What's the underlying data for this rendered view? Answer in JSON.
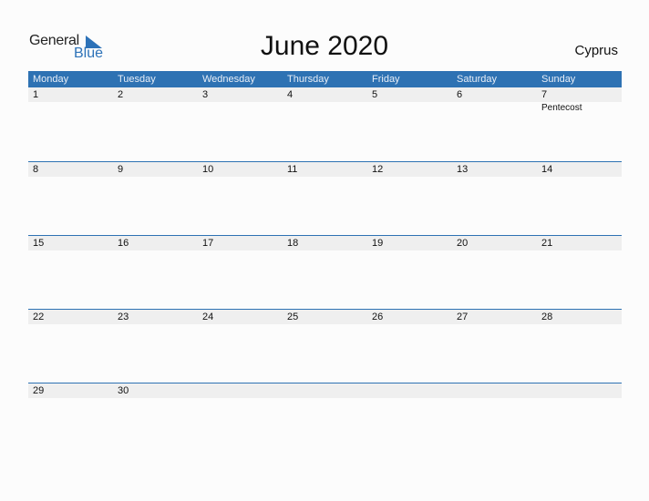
{
  "logo": {
    "general": "General",
    "blue": "Blue"
  },
  "title": "June 2020",
  "country": "Cyprus",
  "colors": {
    "accent": "#2e72b3",
    "day_row_bg": "#efefef"
  },
  "weekdays": [
    "Monday",
    "Tuesday",
    "Wednesday",
    "Thursday",
    "Friday",
    "Saturday",
    "Sunday"
  ],
  "weeks": [
    {
      "days": [
        "1",
        "2",
        "3",
        "4",
        "5",
        "6",
        "7"
      ],
      "events": [
        "",
        "",
        "",
        "",
        "",
        "",
        "Pentecost"
      ]
    },
    {
      "days": [
        "8",
        "9",
        "10",
        "11",
        "12",
        "13",
        "14"
      ],
      "events": [
        "",
        "",
        "",
        "",
        "",
        "",
        ""
      ]
    },
    {
      "days": [
        "15",
        "16",
        "17",
        "18",
        "19",
        "20",
        "21"
      ],
      "events": [
        "",
        "",
        "",
        "",
        "",
        "",
        ""
      ]
    },
    {
      "days": [
        "22",
        "23",
        "24",
        "25",
        "26",
        "27",
        "28"
      ],
      "events": [
        "",
        "",
        "",
        "",
        "",
        "",
        ""
      ]
    },
    {
      "days": [
        "29",
        "30",
        "",
        "",
        "",
        "",
        ""
      ],
      "events": [
        "",
        "",
        "",
        "",
        "",
        "",
        ""
      ]
    }
  ]
}
